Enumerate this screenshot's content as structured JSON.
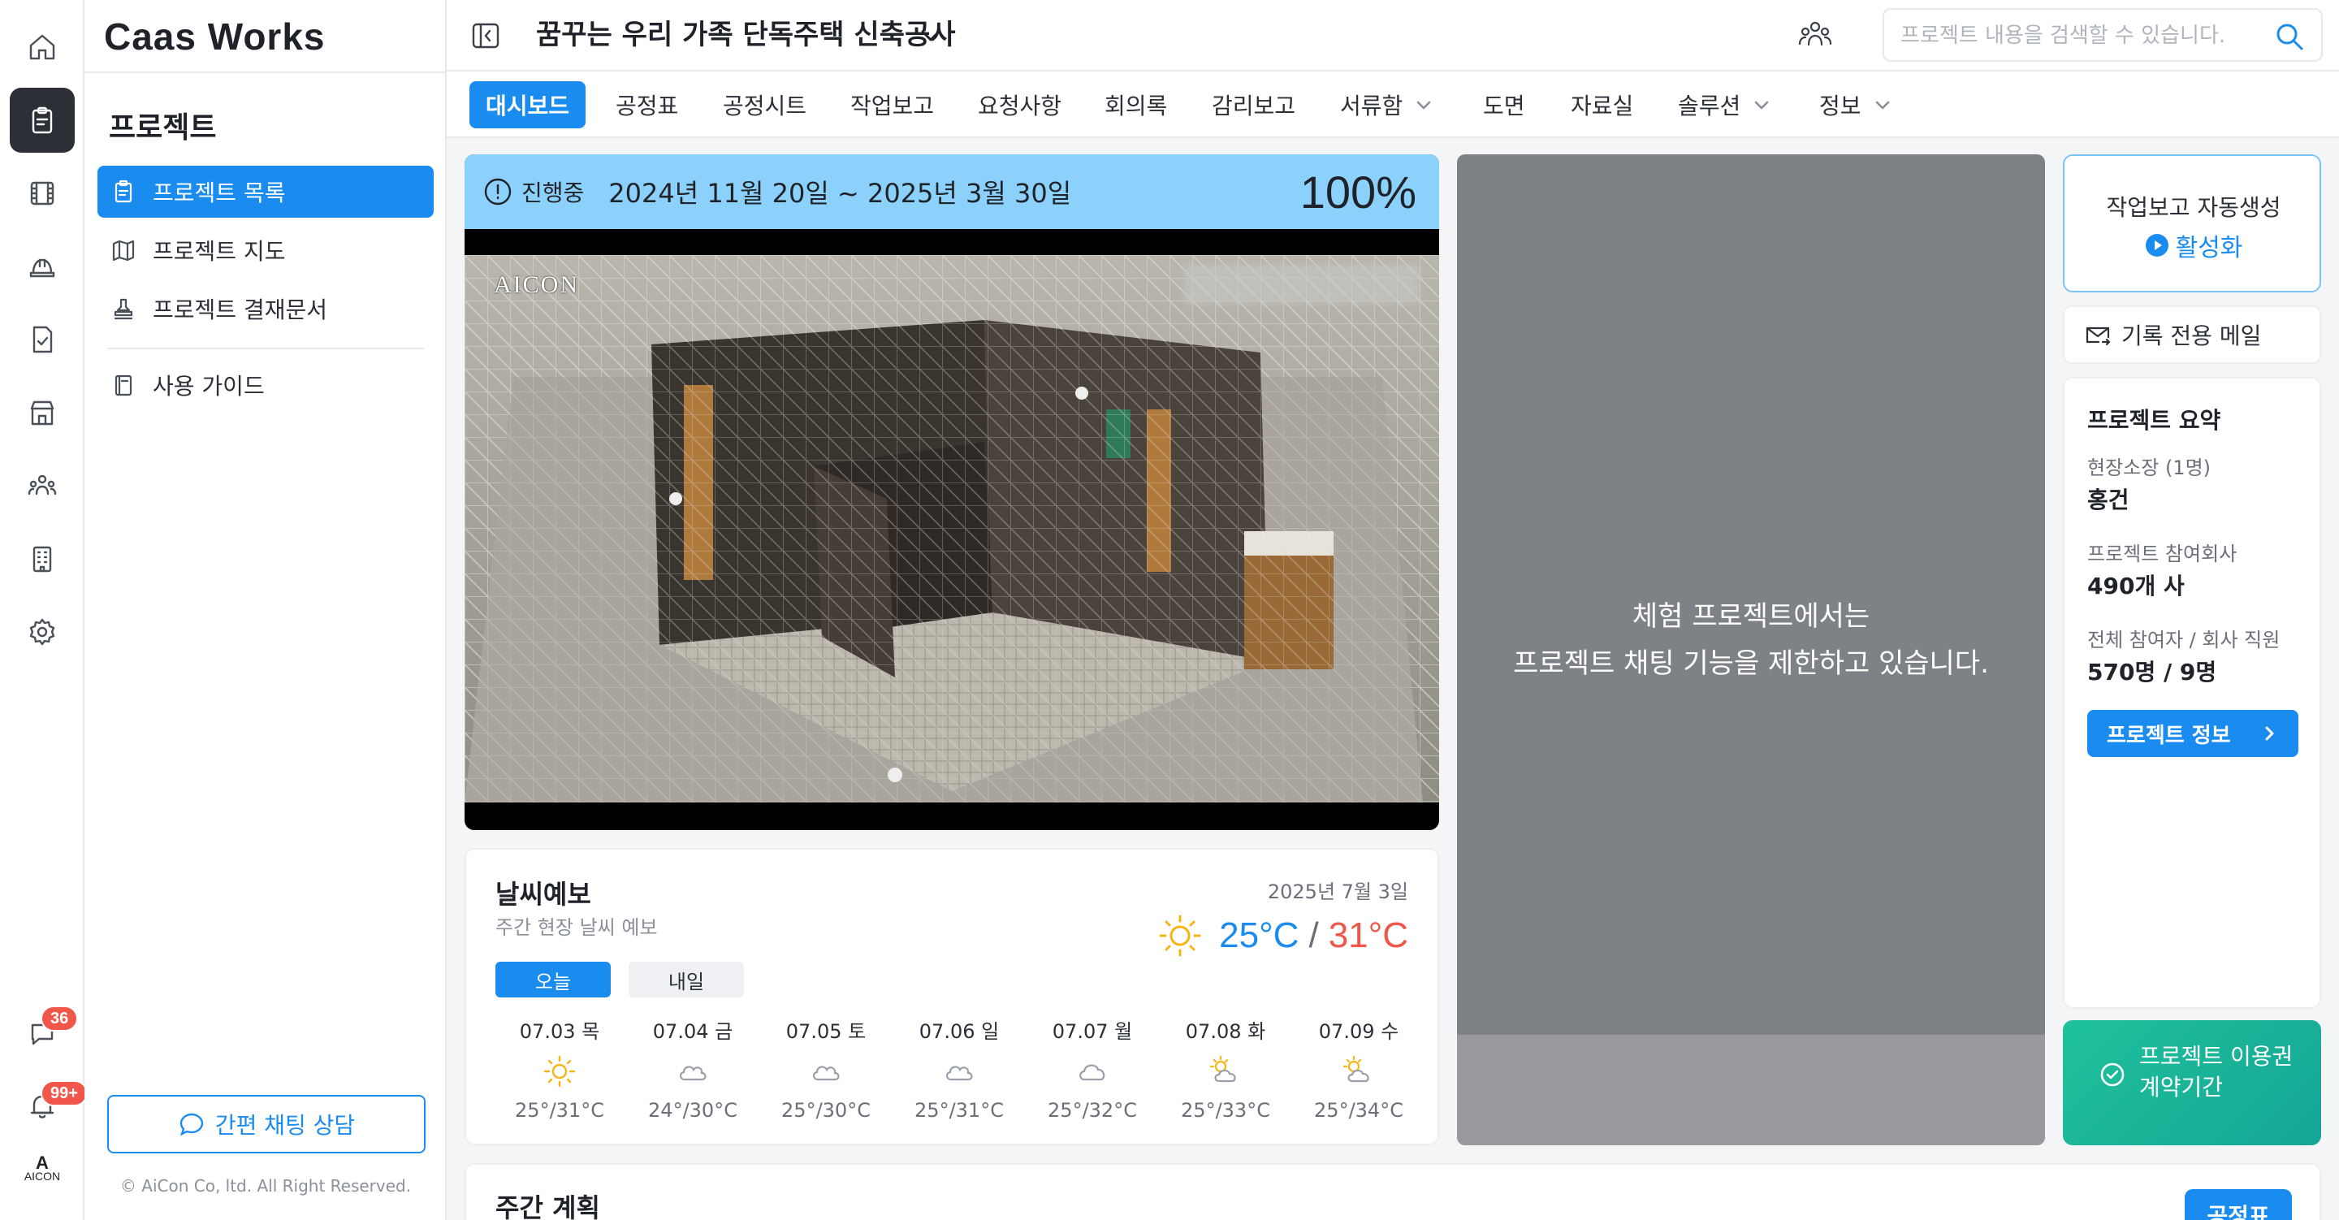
{
  "rail": {
    "items": [
      {
        "icon": "home-icon"
      },
      {
        "icon": "clipboard-icon",
        "active": true
      },
      {
        "icon": "film-icon"
      },
      {
        "icon": "hardhat-icon"
      },
      {
        "icon": "file-check-icon"
      },
      {
        "icon": "store-icon"
      },
      {
        "icon": "people-icon"
      },
      {
        "icon": "building-icon"
      },
      {
        "icon": "gear-icon"
      }
    ],
    "chat_badge": "36",
    "notification_badge": "99+",
    "logo_letter": "A",
    "logo_text": "AICON"
  },
  "sidebar": {
    "brand": "Caas Works",
    "section_title": "프로젝트",
    "nav": {
      "list": "프로젝트 목록",
      "map": "프로젝트 지도",
      "approval": "프로젝트 결재문서",
      "guide": "사용 가이드"
    },
    "chat_consult": "간편 채팅 상담",
    "copyright": "© AiCon Co, ltd. All Right Reserved."
  },
  "header": {
    "project_name": "꿈꾸는 우리 가족 단독주택 신축공사",
    "search_placeholder": "프로젝트 내용을 검색할 수 있습니다.",
    "search_value": ""
  },
  "tabs": [
    {
      "label": "대시보드",
      "active": true
    },
    {
      "label": "공정표"
    },
    {
      "label": "공정시트"
    },
    {
      "label": "작업보고"
    },
    {
      "label": "요청사항"
    },
    {
      "label": "회의록"
    },
    {
      "label": "감리보고"
    },
    {
      "label": "서류함",
      "dropdown": true
    },
    {
      "label": "도면"
    },
    {
      "label": "자료실"
    },
    {
      "label": "솔루션",
      "dropdown": true
    },
    {
      "label": "정보",
      "dropdown": true
    }
  ],
  "status": {
    "label": "진행중",
    "period": "2024년 11월 20일 ~ 2025년 3월 30일",
    "percent": "100%",
    "camera_label": "AICON"
  },
  "weather": {
    "title": "날씨예보",
    "subtitle": "주간 현장 날씨 예보",
    "date": "2025년 7월 3일",
    "now": {
      "low": "25°C",
      "sep": "/",
      "high": "31°C",
      "icon": "sun-icon"
    },
    "tab_today": "오늘",
    "tab_tomorrow": "내일",
    "days": [
      {
        "label": "07.03 목",
        "temp": "25°/31°C",
        "icon": "sun-icon"
      },
      {
        "label": "07.04 금",
        "temp": "24°/30°C",
        "icon": "cloudy-icon"
      },
      {
        "label": "07.05 토",
        "temp": "25°/30°C",
        "icon": "cloudy-icon"
      },
      {
        "label": "07.06 일",
        "temp": "25°/31°C",
        "icon": "cloudy-icon"
      },
      {
        "label": "07.07 월",
        "temp": "25°/32°C",
        "icon": "cloud-icon"
      },
      {
        "label": "07.08 화",
        "temp": "25°/33°C",
        "icon": "partly-cloudy-icon"
      },
      {
        "label": "07.09 수",
        "temp": "25°/34°C",
        "icon": "partly-cloudy-icon"
      }
    ]
  },
  "chat": {
    "notice_line1": "체험 프로젝트에서는",
    "notice_line2": "프로젝트 채팅 기능을 제한하고 있습니다."
  },
  "right": {
    "autogen_title": "작업보고 자동생성",
    "autogen_action": "활성화",
    "mail_label": "기록 전용 메일",
    "summary": {
      "title": "프로젝트 요약",
      "manager_label": "현장소장 (1명)",
      "manager_value": "홍건",
      "companies_label": "프로젝트 참여회사",
      "companies_value": "490개 사",
      "participants_label": "전체 참여자 / 회사 직원",
      "participants_value": "570명 / 9명",
      "info_button": "프로젝트 정보"
    },
    "license_text": "프로젝트 이용권 계약기간"
  },
  "weekly": {
    "title": "주간 계획",
    "button": "공정표"
  },
  "colors": {
    "accent": "#1a8cf0",
    "status_header": "#8bd1fb",
    "temp_low": "#1a8cf0",
    "temp_high": "#f0574a",
    "license_green": "#1fc29b",
    "badge_red": "#f0574a"
  }
}
